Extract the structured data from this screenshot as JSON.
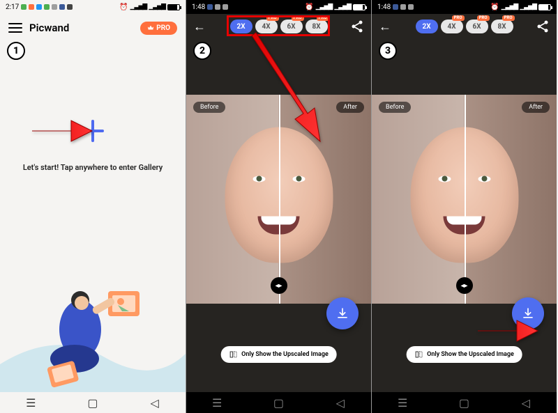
{
  "screen1": {
    "statusbar": {
      "time": "2:17",
      "battery_pct": 80
    },
    "app_title": "Picwand",
    "pro_badge": "PRO",
    "start_text": "Let's start! Tap anywhere to enter Gallery"
  },
  "screen2": {
    "statusbar": {
      "time": "1:48",
      "battery_pct": 80
    },
    "zoom_options": [
      {
        "label": "2X",
        "active": true,
        "pro": false
      },
      {
        "label": "4X",
        "active": false,
        "pro": true
      },
      {
        "label": "6X",
        "active": false,
        "pro": true
      },
      {
        "label": "8X",
        "active": false,
        "pro": true
      }
    ],
    "pro_tag": "PRO",
    "before_label": "Before",
    "after_label": "After",
    "only_show_label": "Only Show the Upscaled Image"
  },
  "screen3": {
    "statusbar": {
      "time": "1:48",
      "battery_pct": 80
    },
    "zoom_options": [
      {
        "label": "2X",
        "active": true,
        "pro": false
      },
      {
        "label": "4X",
        "active": false,
        "pro": true
      },
      {
        "label": "6X",
        "active": false,
        "pro": true
      },
      {
        "label": "8X",
        "active": false,
        "pro": true
      }
    ],
    "pro_tag": "PRO",
    "before_label": "Before",
    "after_label": "After",
    "only_show_label": "Only Show the Upscaled Image"
  },
  "steps": {
    "s1": "1",
    "s2": "2",
    "s3": "3"
  }
}
